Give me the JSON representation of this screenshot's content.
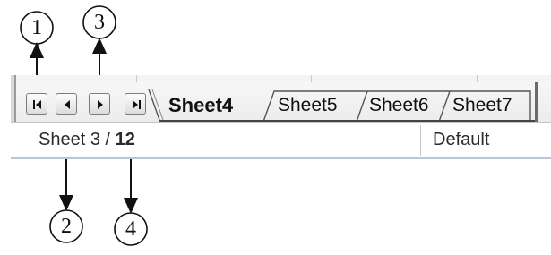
{
  "sheet_tabs": [
    {
      "label": "Sheet4",
      "active": true
    },
    {
      "label": "Sheet5",
      "active": false
    },
    {
      "label": "Sheet6",
      "active": false
    },
    {
      "label": "Sheet7",
      "active": false
    }
  ],
  "nav_buttons": [
    {
      "icon": "first-sheet-icon"
    },
    {
      "icon": "previous-sheet-icon"
    },
    {
      "icon": "next-sheet-icon"
    },
    {
      "icon": "last-sheet-icon"
    }
  ],
  "status_bar": {
    "sheet_prefix": "Sheet 3 / ",
    "sheet_total": "12",
    "page_style": "Default"
  },
  "callouts": [
    "1",
    "2",
    "3",
    "4"
  ],
  "colors": {
    "tab_border": "#555555",
    "button_border": "#7c7c7c",
    "status_separator": "#c9c9c9"
  }
}
